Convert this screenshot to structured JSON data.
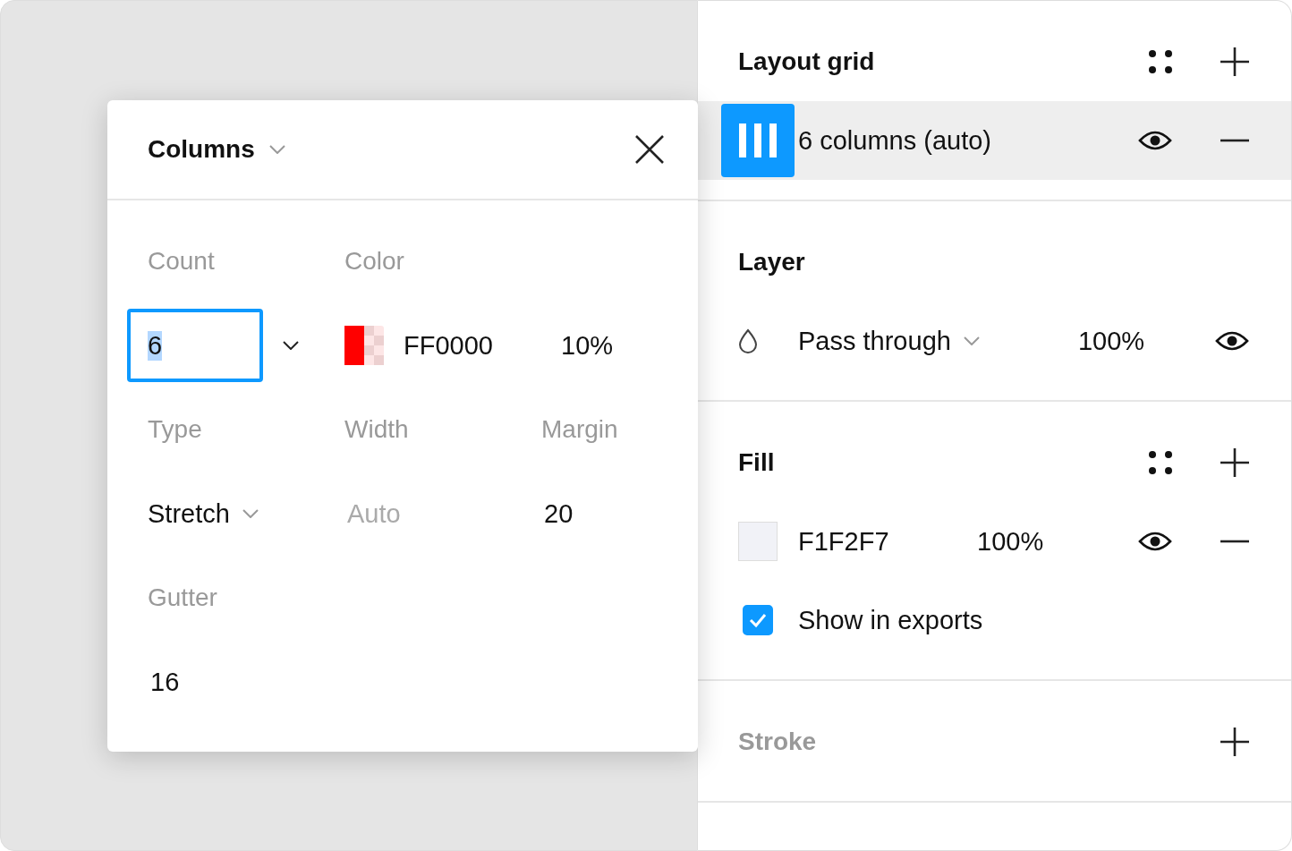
{
  "columns_popover": {
    "title": "Columns",
    "count": {
      "label": "Count",
      "value": "6",
      "focused": true
    },
    "color": {
      "label": "Color",
      "hex": "FF0000",
      "opacity": "10%",
      "color": "#ff0000"
    },
    "type": {
      "label": "Type",
      "value": "Stretch"
    },
    "width": {
      "label": "Width",
      "placeholder": "Auto"
    },
    "margin": {
      "label": "Margin",
      "value": "20"
    },
    "gutter": {
      "label": "Gutter",
      "value": "16"
    }
  },
  "layout_grid": {
    "title": "Layout grid",
    "grids": [
      {
        "label": "6 columns (auto)",
        "selected": true,
        "visible": true
      }
    ]
  },
  "layer": {
    "title": "Layer",
    "blend_mode": "Pass through",
    "opacity": "100%",
    "visible": true
  },
  "fill": {
    "title": "Fill",
    "hex": "F1F2F7",
    "color": "#f1f2f7",
    "opacity": "100%",
    "visible": true,
    "show_in_exports": {
      "label": "Show in exports",
      "checked": true
    }
  },
  "stroke": {
    "title": "Stroke",
    "empty": true
  }
}
